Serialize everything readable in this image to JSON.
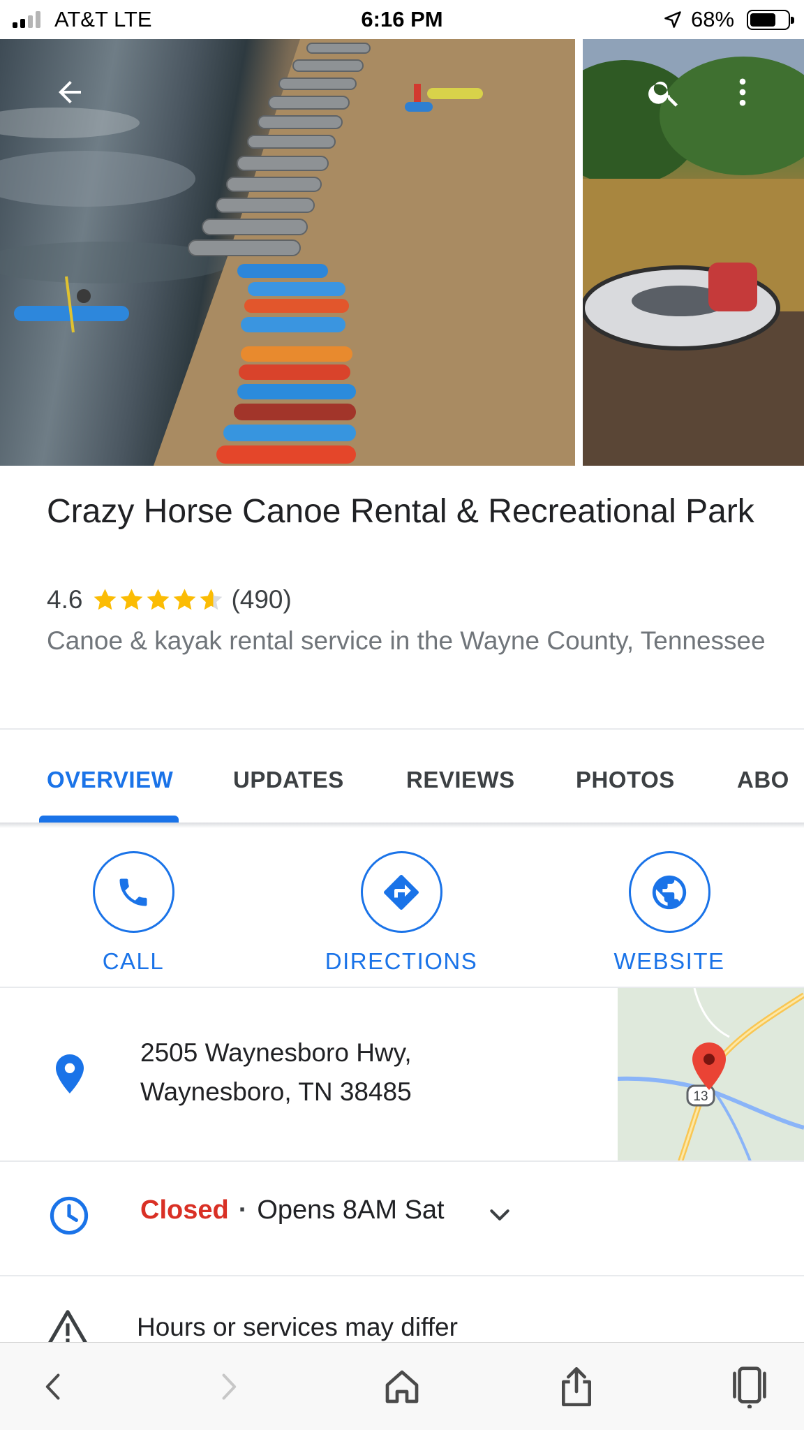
{
  "status_bar": {
    "carrier": "AT&T  LTE",
    "time": "6:16 PM",
    "battery": "68%",
    "battery_level": 0.68,
    "signal_bars": 2
  },
  "header": {
    "back_icon": "arrow-left-icon",
    "search_icon": "search-icon",
    "menu_icon": "more-vert-icon"
  },
  "place": {
    "name": "Crazy Horse Canoe Rental & Recreational Park",
    "rating": "4.6",
    "rating_value": 4.6,
    "review_count": "(490)",
    "category": "Canoe & kayak rental service in the Wayne County, Tennessee"
  },
  "tabs": [
    {
      "label": "OVERVIEW",
      "active": true
    },
    {
      "label": "UPDATES",
      "active": false
    },
    {
      "label": "REVIEWS",
      "active": false
    },
    {
      "label": "PHOTOS",
      "active": false
    },
    {
      "label": "ABO",
      "active": false
    }
  ],
  "actions": {
    "call": "CALL",
    "directions": "DIRECTIONS",
    "website": "WEBSITE"
  },
  "address": {
    "line1": "2505 Waynesboro Hwy,",
    "line2": "Waynesboro, TN 38485",
    "map_route_label": "13"
  },
  "hours": {
    "status": "Closed",
    "separator": "·",
    "next_open": "Opens 8AM Sat"
  },
  "notice": {
    "text": "Hours or services may differ"
  },
  "colors": {
    "accent": "#1a73e8",
    "closed": "#d93025",
    "star": "#fbbc04",
    "map_pin": "#ea4335"
  },
  "toolbar": {
    "icons": [
      "back-icon",
      "forward-icon",
      "home-icon",
      "share-icon",
      "tabs-icon"
    ]
  }
}
